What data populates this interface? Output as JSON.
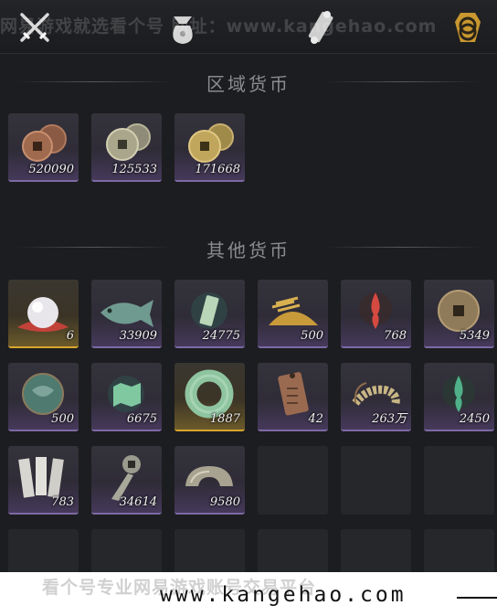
{
  "topbar": {
    "tabs": [
      {
        "icon": "crossed-swords-icon"
      },
      {
        "icon": "money-pouch-icon"
      },
      {
        "icon": "scroll-icon"
      },
      {
        "icon": "coin-stack-icon",
        "active": true
      }
    ],
    "watermark": "网易游戏就选看个号  网址：www.kangehao.com"
  },
  "sections": {
    "regional": "区域货币",
    "other": "其他货币"
  },
  "regional_items": [
    {
      "icon": "copper-coins-icon",
      "count": "520090",
      "rarity": "common"
    },
    {
      "icon": "silver-coins-icon",
      "count": "125533",
      "rarity": "common"
    },
    {
      "icon": "gold-coins-icon",
      "count": "171668",
      "rarity": "common"
    }
  ],
  "other_items": [
    {
      "icon": "pearl-icon",
      "count": "6",
      "rarity": "gold"
    },
    {
      "icon": "jade-fish-icon",
      "count": "33909",
      "rarity": "common"
    },
    {
      "icon": "jade-token-icon",
      "count": "24775",
      "rarity": "common"
    },
    {
      "icon": "grain-pile-icon",
      "count": "500",
      "rarity": "common"
    },
    {
      "icon": "red-flame-icon",
      "count": "768",
      "rarity": "common"
    },
    {
      "icon": "bronze-coin-icon",
      "count": "5349",
      "rarity": "common"
    },
    {
      "icon": "jade-disc-icon",
      "count": "500",
      "rarity": "common"
    },
    {
      "icon": "jade-map-icon",
      "count": "6675",
      "rarity": "common"
    },
    {
      "icon": "jade-ring-icon",
      "count": "1887",
      "rarity": "gold"
    },
    {
      "icon": "bronze-plaque-icon",
      "count": "42",
      "rarity": "common"
    },
    {
      "icon": "coin-string-icon",
      "count": "263万",
      "rarity": "common"
    },
    {
      "icon": "green-flame-icon",
      "count": "2450",
      "rarity": "common"
    },
    {
      "icon": "silver-notes-icon",
      "count": "783",
      "rarity": "common"
    },
    {
      "icon": "spade-coin-icon",
      "count": "34614",
      "rarity": "common"
    },
    {
      "icon": "silver-ingot-icon",
      "count": "9580",
      "rarity": "common"
    }
  ],
  "banner": {
    "faint_text": "看个号专业网易游戏账号交易平台",
    "url": "www.kangehao.com"
  },
  "colors": {
    "common_border": "#7c6aa4",
    "gold_border": "#d9a52e",
    "background": "#1c1d20"
  }
}
